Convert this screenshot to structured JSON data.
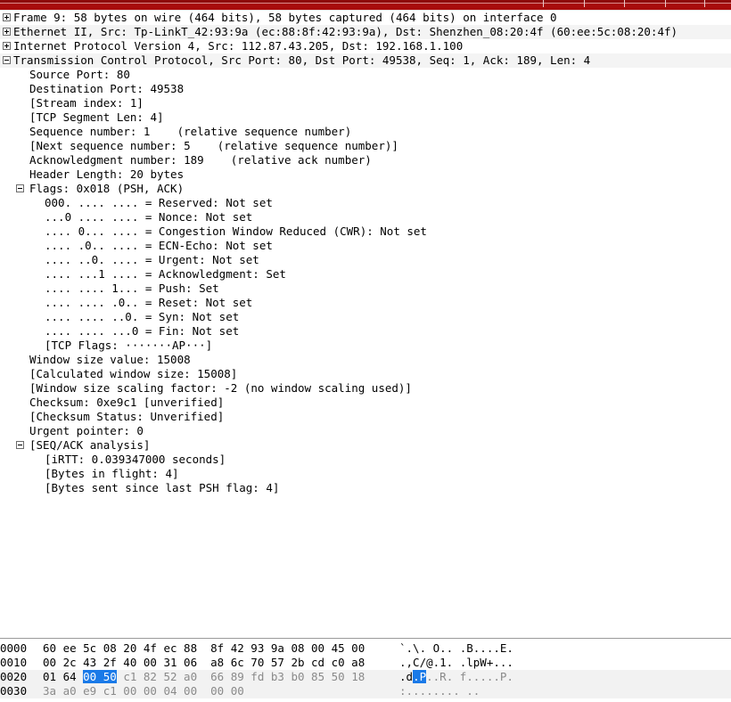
{
  "window": {
    "app": "Wireshark",
    "accent_color": "#a80c0c",
    "selection_color": "#1a7ae8"
  },
  "detail_tree": {
    "rows": [
      {
        "indent": 0,
        "expander": "plus",
        "text": "Frame 9: 58 bytes on wire (464 bits), 58 bytes captured (464 bits) on interface 0",
        "name": "tree-node-frame"
      },
      {
        "indent": 0,
        "expander": "plus",
        "text": "Ethernet II, Src: Tp-LinkT_42:93:9a (ec:88:8f:42:93:9a), Dst: Shenzhen_08:20:4f (60:ee:5c:08:20:4f)",
        "name": "tree-node-ethernet"
      },
      {
        "indent": 0,
        "expander": "plus",
        "text": "Internet Protocol Version 4, Src: 112.87.43.205, Dst: 192.168.1.100",
        "name": "tree-node-ipv4"
      },
      {
        "indent": 0,
        "expander": "minus",
        "text": "Transmission Control Protocol, Src Port: 80, Dst Port: 49538, Seq: 1, Ack: 189, Len: 4",
        "name": "tree-node-tcp"
      },
      {
        "indent": 1,
        "expander": "none",
        "text": "Source Port: 80",
        "name": "tcp-source-port"
      },
      {
        "indent": 1,
        "expander": "none",
        "text": "Destination Port: 49538",
        "name": "tcp-destination-port"
      },
      {
        "indent": 1,
        "expander": "none",
        "text": "[Stream index: 1]",
        "name": "tcp-stream-index"
      },
      {
        "indent": 1,
        "expander": "none",
        "text": "[TCP Segment Len: 4]",
        "name": "tcp-segment-len"
      },
      {
        "indent": 1,
        "expander": "none",
        "text": "Sequence number: 1    (relative sequence number)",
        "name": "tcp-sequence-number"
      },
      {
        "indent": 1,
        "expander": "none",
        "text": "[Next sequence number: 5    (relative sequence number)]",
        "name": "tcp-next-sequence-number"
      },
      {
        "indent": 1,
        "expander": "none",
        "text": "Acknowledgment number: 189    (relative ack number)",
        "name": "tcp-acknowledgment-number"
      },
      {
        "indent": 1,
        "expander": "none",
        "text": "Header Length: 20 bytes",
        "name": "tcp-header-length"
      },
      {
        "indent": 1,
        "expander": "minus",
        "text": "Flags: 0x018 (PSH, ACK)",
        "name": "tcp-flags-node"
      },
      {
        "indent": 2,
        "expander": "none",
        "text": "000. .... .... = Reserved: Not set",
        "name": "tcp-flag-reserved"
      },
      {
        "indent": 2,
        "expander": "none",
        "text": "...0 .... .... = Nonce: Not set",
        "name": "tcp-flag-nonce"
      },
      {
        "indent": 2,
        "expander": "none",
        "text": ".... 0... .... = Congestion Window Reduced (CWR): Not set",
        "name": "tcp-flag-cwr"
      },
      {
        "indent": 2,
        "expander": "none",
        "text": ".... .0.. .... = ECN-Echo: Not set",
        "name": "tcp-flag-ecn-echo"
      },
      {
        "indent": 2,
        "expander": "none",
        "text": ".... ..0. .... = Urgent: Not set",
        "name": "tcp-flag-urgent"
      },
      {
        "indent": 2,
        "expander": "none",
        "text": ".... ...1 .... = Acknowledgment: Set",
        "name": "tcp-flag-acknowledgment"
      },
      {
        "indent": 2,
        "expander": "none",
        "text": ".... .... 1... = Push: Set",
        "name": "tcp-flag-push"
      },
      {
        "indent": 2,
        "expander": "none",
        "text": ".... .... .0.. = Reset: Not set",
        "name": "tcp-flag-reset"
      },
      {
        "indent": 2,
        "expander": "none",
        "text": ".... .... ..0. = Syn: Not set",
        "name": "tcp-flag-syn"
      },
      {
        "indent": 2,
        "expander": "none",
        "text": ".... .... ...0 = Fin: Not set",
        "name": "tcp-flag-fin"
      },
      {
        "indent": 2,
        "expander": "none",
        "text": "[TCP Flags: ·······AP···]",
        "name": "tcp-flags-summary"
      },
      {
        "indent": 1,
        "expander": "none",
        "text": "Window size value: 15008",
        "name": "tcp-window-size-value"
      },
      {
        "indent": 1,
        "expander": "none",
        "text": "[Calculated window size: 15008]",
        "name": "tcp-calculated-window-size"
      },
      {
        "indent": 1,
        "expander": "none",
        "text": "[Window size scaling factor: -2 (no window scaling used)]",
        "name": "tcp-window-scaling-factor"
      },
      {
        "indent": 1,
        "expander": "none",
        "text": "Checksum: 0xe9c1 [unverified]",
        "name": "tcp-checksum"
      },
      {
        "indent": 1,
        "expander": "none",
        "text": "[Checksum Status: Unverified]",
        "name": "tcp-checksum-status"
      },
      {
        "indent": 1,
        "expander": "none",
        "text": "Urgent pointer: 0",
        "name": "tcp-urgent-pointer"
      },
      {
        "indent": 1,
        "expander": "minus",
        "text": "[SEQ/ACK analysis]",
        "name": "tcp-seq-ack-analysis-node"
      },
      {
        "indent": 2,
        "expander": "none",
        "text": "[iRTT: 0.039347000 seconds]",
        "name": "tcp-irtt"
      },
      {
        "indent": 2,
        "expander": "none",
        "text": "[Bytes in flight: 4]",
        "name": "tcp-bytes-in-flight"
      },
      {
        "indent": 2,
        "expander": "none",
        "text": "[Bytes sent since last PSH flag: 4]",
        "name": "tcp-bytes-since-psh"
      }
    ]
  },
  "hex_dump": {
    "rows": [
      {
        "offset": "0000",
        "name": "hex-row-0000",
        "shaded": false,
        "segments": [
          {
            "text": "60 ee 5c 08 20 4f ec 88  8f 42 93 9a 08 00 45 00",
            "style": "normal"
          }
        ],
        "ascii_segments": [
          {
            "text": "`.\\. O.. .B....E.",
            "style": "normal"
          }
        ]
      },
      {
        "offset": "0010",
        "name": "hex-row-0010",
        "shaded": false,
        "segments": [
          {
            "text": "00 2c 43 2f 40 00 31 06  a8 6c 70 57 2b cd c0 a8",
            "style": "normal"
          }
        ],
        "ascii_segments": [
          {
            "text": ".,C/@.1. .lpW+...",
            "style": "normal"
          }
        ]
      },
      {
        "offset": "0020",
        "name": "hex-row-0020",
        "shaded": true,
        "segments": [
          {
            "text": "01 64 ",
            "style": "normal"
          },
          {
            "text": "00 50",
            "style": "selected"
          },
          {
            "text": " c1 82 52 a0  66 89 fd b3 b0 85 50 18",
            "style": "dim"
          }
        ],
        "ascii_segments": [
          {
            "text": ".d",
            "style": "normal"
          },
          {
            "text": ".P",
            "style": "selected"
          },
          {
            "text": "..R. f.....P.",
            "style": "dim"
          }
        ]
      },
      {
        "offset": "0030",
        "name": "hex-row-0030",
        "shaded": true,
        "segments": [
          {
            "text": "3a a0 e9 c1 00 00 04 00  00 00",
            "style": "dim"
          }
        ],
        "ascii_segments": [
          {
            "text": ":........ ..",
            "style": "dim"
          }
        ]
      }
    ]
  }
}
